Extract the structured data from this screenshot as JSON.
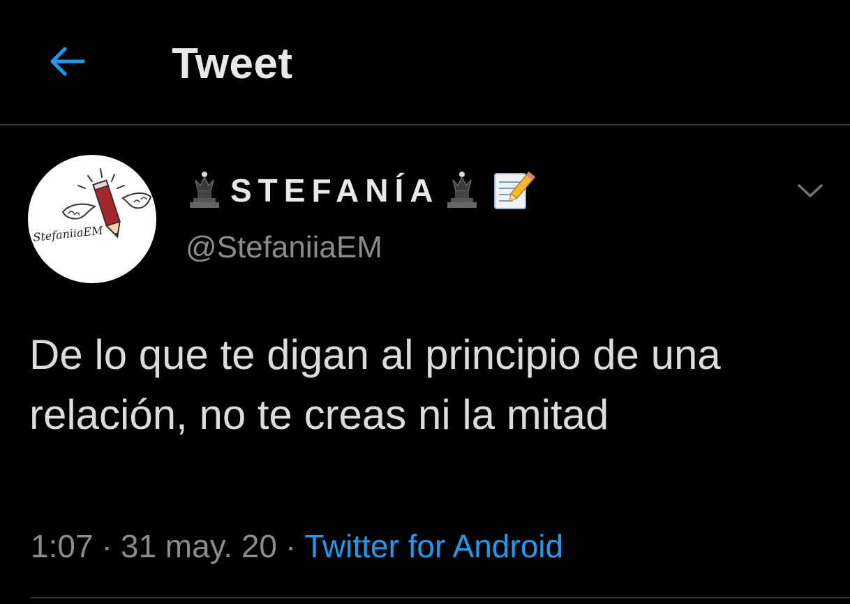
{
  "header": {
    "title": "Tweet",
    "back_icon": "back-arrow-icon"
  },
  "author": {
    "display_name": "STEFANÍA",
    "handle": "@StefaniiaEM",
    "avatar_text": "StefaniiaEM",
    "name_prefix_icon": "chess-queen-icon",
    "name_suffix_icons": [
      "chess-queen-icon",
      "memo-icon"
    ]
  },
  "tweet": {
    "text": "De lo que te digan al principio de una relación, no te creas ni la mitad",
    "time": "1:07",
    "separator": "·",
    "date": "31 may. 20",
    "source": "Twitter for Android"
  },
  "colors": {
    "background": "#000000",
    "accent": "#1d9bf0",
    "text_primary": "#dcdcdc",
    "text_secondary": "#8b8b8b",
    "divider": "#2f3336"
  }
}
